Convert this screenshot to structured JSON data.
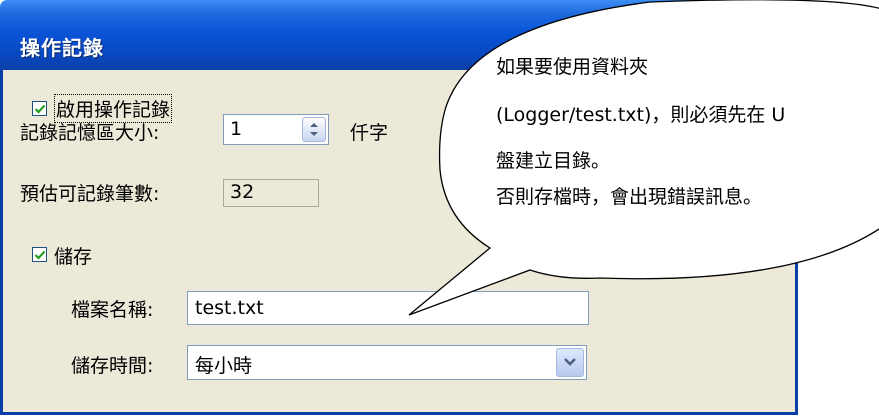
{
  "dialog": {
    "title": "操作記錄",
    "enable_logging": {
      "label": "啟用操作記錄",
      "checked": true
    },
    "memory_size": {
      "label": "記錄記憶區大小:",
      "value": "1",
      "unit": "仟字"
    },
    "estimated_count": {
      "label": "預估可記錄筆數:",
      "value": "32"
    },
    "save": {
      "label": "儲存",
      "checked": true
    },
    "filename": {
      "label": "檔案名稱:",
      "value": "test.txt"
    },
    "save_interval": {
      "label": "儲存時間:",
      "selected": "每小時"
    }
  },
  "callout": {
    "lines": [
      "如果要使用資料夾",
      "(Logger/test.txt)，則必須先在 U",
      "盤建立目錄。",
      "否則存檔時，會出現錯誤訊息。"
    ]
  },
  "colors": {
    "titlebar": "#0a54d8",
    "dialog_bg": "#ece9d8",
    "check": "#21a121",
    "field_border": "#7f9db9"
  }
}
